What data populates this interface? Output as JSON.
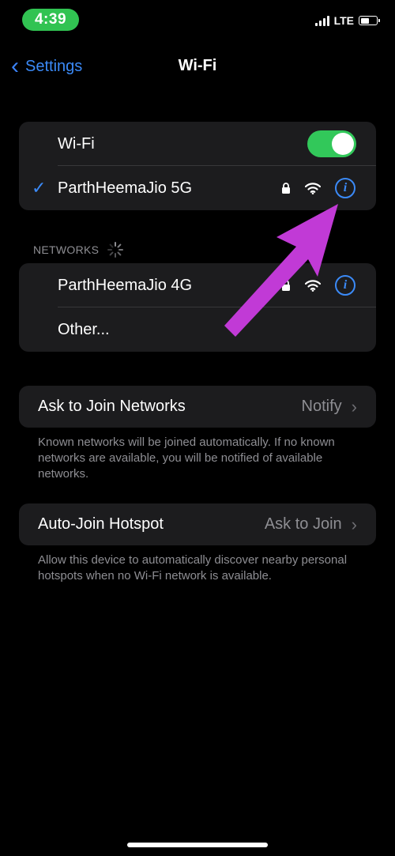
{
  "status_bar": {
    "time": "4:39",
    "carrier": "LTE"
  },
  "nav": {
    "back_label": "Settings",
    "title": "Wi-Fi"
  },
  "wifi_group": {
    "toggle_label": "Wi-Fi",
    "toggle_on": true,
    "connected_network": "ParthHeemaJio 5G"
  },
  "networks_section": {
    "header": "NETWORKS",
    "items": [
      {
        "name": "ParthHeemaJio 4G"
      },
      {
        "name": "Other..."
      }
    ]
  },
  "ask_to_join": {
    "label": "Ask to Join Networks",
    "value": "Notify",
    "note": "Known networks will be joined automatically. If no known networks are available, you will be notified of available networks."
  },
  "auto_join": {
    "label": "Auto-Join Hotspot",
    "value": "Ask to Join",
    "note": "Allow this device to automatically discover nearby personal hotspots when no Wi-Fi network is available."
  },
  "colors": {
    "accent": "#3b8af7",
    "toggle_on": "#32c85a",
    "annotation_arrow": "#c13ad6"
  }
}
